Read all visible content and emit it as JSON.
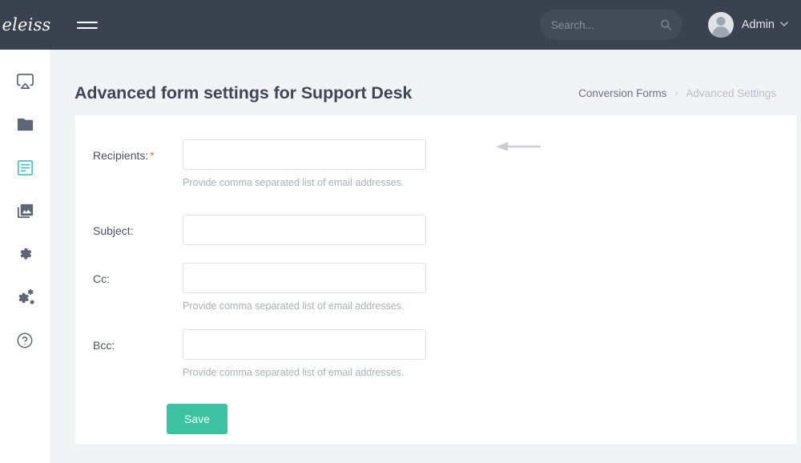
{
  "topbar": {
    "brand": "eleiss",
    "menu_icon": "hamburger-icon",
    "search": {
      "placeholder": "Search...",
      "value": "",
      "icon": "search-icon"
    },
    "user": {
      "name": "Admin",
      "caret": "˅",
      "avatar_icon": "user-avatar-icon"
    }
  },
  "sidebar": {
    "items": [
      {
        "name": "airplay-icon",
        "label": "Dashboard",
        "active": false
      },
      {
        "name": "folder-icon",
        "label": "Files",
        "active": false
      },
      {
        "name": "form-list-icon",
        "label": "Conversion Forms",
        "active": true
      },
      {
        "name": "images-icon",
        "label": "Media",
        "active": false
      },
      {
        "name": "gear-icon",
        "label": "Settings",
        "active": false
      },
      {
        "name": "gears-icon",
        "label": "Advanced Settings",
        "active": false
      },
      {
        "name": "help-circle-icon",
        "label": "Help",
        "active": false
      }
    ]
  },
  "page": {
    "title": "Advanced form settings for Support Desk",
    "breadcrumb": {
      "parent": "Conversion Forms",
      "separator": "›",
      "current": "Advanced Settings"
    }
  },
  "form": {
    "fields": [
      {
        "label": "Recipients:",
        "required": true,
        "required_marker": "*",
        "value": "",
        "help": "Provide comma separated list of email addresses.",
        "annotated": true
      },
      {
        "label": "Subject:",
        "required": false,
        "required_marker": "",
        "value": "",
        "help": "",
        "annotated": false
      },
      {
        "label": "Cc:",
        "required": false,
        "required_marker": "",
        "value": "",
        "help": "Provide comma separated list of email addresses.",
        "annotated": false
      },
      {
        "label": "Bcc:",
        "required": false,
        "required_marker": "",
        "value": "",
        "help": "Provide comma separated list of email addresses.",
        "annotated": false
      }
    ],
    "save_label": "Save"
  },
  "colors": {
    "topbar": "#3a4250",
    "accent_teal": "#4ec3c6",
    "save_green": "#3cc2a0",
    "page_bg": "#f2f3f5",
    "required_red": "#e36767",
    "annotation_gray": "#c9ccd1"
  }
}
